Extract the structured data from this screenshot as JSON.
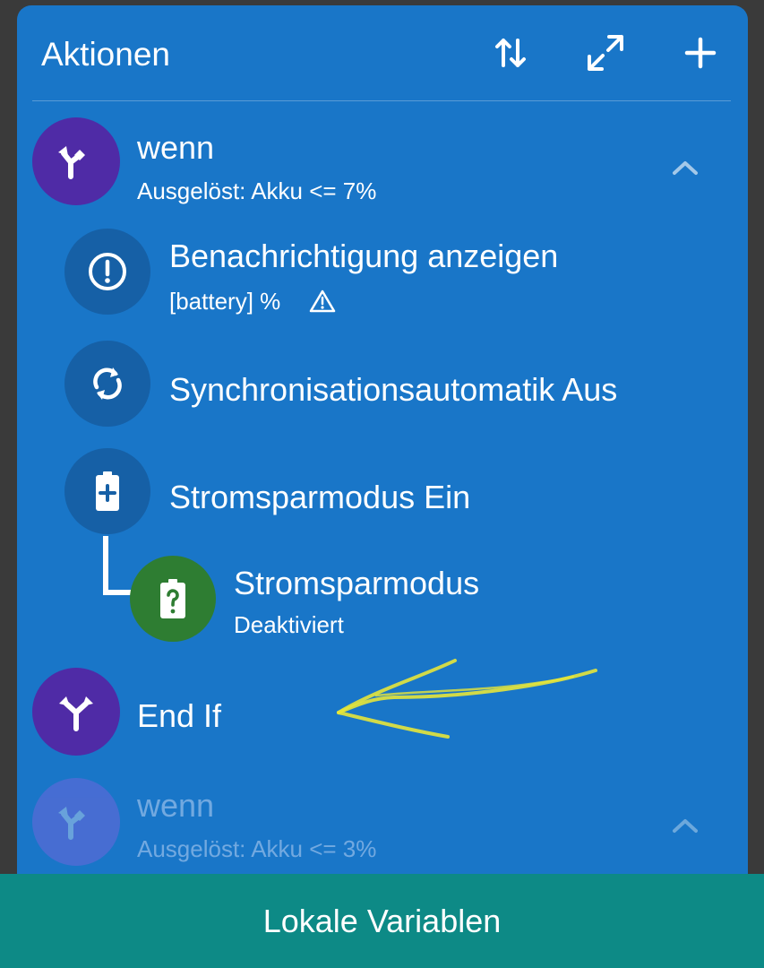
{
  "header": {
    "title": "Aktionen",
    "icons": [
      "sort-arrows-icon",
      "expand-icon",
      "plus-icon"
    ]
  },
  "actions": [
    {
      "title": "wenn",
      "subtitle": "Ausgelöst: Akku <= 7%",
      "icon": "branch-icon",
      "expanded": true
    },
    {
      "title": "Benachrichtigung anzeigen",
      "subtitle": "[battery] %",
      "icon": "alert-circle-icon",
      "warning_icon": "warning-triangle-icon"
    },
    {
      "title": "Synchronisationsautomatik Aus",
      "icon": "sync-icon"
    },
    {
      "title": "Stromsparmodus Ein",
      "icon": "battery-plus-icon"
    },
    {
      "title": "Stromsparmodus",
      "subtitle": "Deaktiviert",
      "icon": "battery-question-icon",
      "type": "constraint"
    },
    {
      "title": "End If",
      "icon": "branch-icon"
    },
    {
      "title": "wenn",
      "subtitle": "Ausgelöst: Akku <= 3%",
      "icon": "branch-icon",
      "disabled": true
    }
  ],
  "footer": {
    "label": "Lokale Variablen"
  },
  "colors": {
    "card": "#1976c8",
    "condition_circle": "#4f2ba6",
    "action_circle": "#1660a6",
    "constraint_circle": "#2e7d32",
    "footer": "#0d8a86",
    "annotation_arrow": "#e6e63a"
  }
}
